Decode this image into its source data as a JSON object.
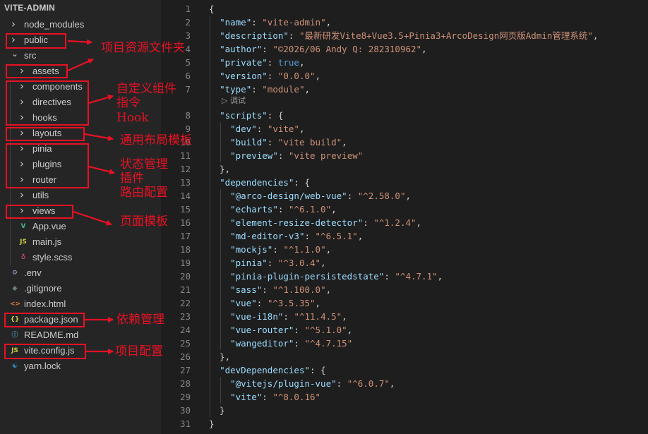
{
  "explorer": {
    "title": "VITE-ADMIN",
    "items": [
      {
        "label": "node_modules",
        "type": "folder",
        "depth": 0,
        "icon": "chevron-right-icon"
      },
      {
        "label": "public",
        "type": "folder",
        "depth": 0,
        "icon": "chevron-right-icon"
      },
      {
        "label": "src",
        "type": "folder-open",
        "depth": 0,
        "icon": "chevron-down-icon"
      },
      {
        "label": "assets",
        "type": "folder",
        "depth": 1,
        "icon": "chevron-right-icon"
      },
      {
        "label": "components",
        "type": "folder",
        "depth": 1,
        "icon": "chevron-right-icon"
      },
      {
        "label": "directives",
        "type": "folder",
        "depth": 1,
        "icon": "chevron-right-icon"
      },
      {
        "label": "hooks",
        "type": "folder",
        "depth": 1,
        "icon": "chevron-right-icon"
      },
      {
        "label": "layouts",
        "type": "folder",
        "depth": 1,
        "icon": "chevron-right-icon"
      },
      {
        "label": "pinia",
        "type": "folder",
        "depth": 1,
        "icon": "chevron-right-icon"
      },
      {
        "label": "plugins",
        "type": "folder",
        "depth": 1,
        "icon": "chevron-right-icon"
      },
      {
        "label": "router",
        "type": "folder",
        "depth": 1,
        "icon": "chevron-right-icon"
      },
      {
        "label": "utils",
        "type": "folder",
        "depth": 1,
        "icon": "chevron-right-icon"
      },
      {
        "label": "views",
        "type": "folder",
        "depth": 1,
        "icon": "chevron-right-icon"
      },
      {
        "label": "App.vue",
        "type": "file",
        "depth": 1,
        "icon": "vue-file-icon",
        "icon_color": "#41b883"
      },
      {
        "label": "main.js",
        "type": "file",
        "depth": 1,
        "icon": "js-file-icon",
        "icon_color": "#cbcb41"
      },
      {
        "label": "style.scss",
        "type": "file",
        "depth": 1,
        "icon": "scss-file-icon",
        "icon_color": "#f55385"
      },
      {
        "label": ".env",
        "type": "file",
        "depth": 0,
        "icon": "gear-icon",
        "icon_color": "#8da0cb"
      },
      {
        "label": ".gitignore",
        "type": "file",
        "depth": 0,
        "icon": "git-icon",
        "icon_color": "#6d8086"
      },
      {
        "label": "index.html",
        "type": "file",
        "depth": 0,
        "icon": "html-file-icon",
        "icon_color": "#e37933"
      },
      {
        "label": "package.json",
        "type": "file",
        "depth": 0,
        "icon": "json-file-icon",
        "icon_color": "#cbcb41"
      },
      {
        "label": "README.md",
        "type": "file",
        "depth": 0,
        "icon": "info-icon",
        "icon_color": "#519aba"
      },
      {
        "label": "vite.config.js",
        "type": "file",
        "depth": 0,
        "icon": "js-file-icon",
        "icon_color": "#cbcb41"
      },
      {
        "label": "yarn.lock",
        "type": "file",
        "depth": 0,
        "icon": "yarn-icon",
        "icon_color": "#2c8ebb"
      }
    ]
  },
  "editor": {
    "lines": [
      {
        "n": "1",
        "tokens": [
          [
            "p",
            "{"
          ]
        ]
      },
      {
        "n": "2",
        "tokens": [
          [
            "p",
            "  "
          ],
          [
            "k",
            "\"name\""
          ],
          [
            "p",
            ": "
          ],
          [
            "s",
            "\"vite-admin\""
          ],
          [
            "p",
            ","
          ]
        ]
      },
      {
        "n": "3",
        "tokens": [
          [
            "p",
            "  "
          ],
          [
            "k",
            "\"description\""
          ],
          [
            "p",
            ": "
          ],
          [
            "s",
            "\"最新研发Vite8+Vue3.5+Pinia3+ArcoDesign网页版Admin管理系统\""
          ],
          [
            "p",
            ","
          ]
        ]
      },
      {
        "n": "4",
        "tokens": [
          [
            "p",
            "  "
          ],
          [
            "k",
            "\"author\""
          ],
          [
            "p",
            ": "
          ],
          [
            "s",
            "\"©2026/06 Andy Q: 282310962\""
          ],
          [
            "p",
            ","
          ]
        ]
      },
      {
        "n": "5",
        "tokens": [
          [
            "p",
            "  "
          ],
          [
            "k",
            "\"private\""
          ],
          [
            "p",
            ": "
          ],
          [
            "b",
            "true"
          ],
          [
            "p",
            ","
          ]
        ]
      },
      {
        "n": "6",
        "tokens": [
          [
            "p",
            "  "
          ],
          [
            "k",
            "\"version\""
          ],
          [
            "p",
            ": "
          ],
          [
            "s",
            "\"0.0.0\""
          ],
          [
            "p",
            ","
          ]
        ]
      },
      {
        "n": "7",
        "tokens": [
          [
            "p",
            "  "
          ],
          [
            "k",
            "\"type\""
          ],
          [
            "p",
            ": "
          ],
          [
            "s",
            "\"module\""
          ],
          [
            "p",
            ","
          ]
        ]
      },
      {
        "n": "8",
        "tokens": [
          [
            "p",
            "  "
          ],
          [
            "k",
            "\"scripts\""
          ],
          [
            "p",
            ": {"
          ]
        ]
      },
      {
        "n": "9",
        "tokens": [
          [
            "p",
            "    "
          ],
          [
            "k",
            "\"dev\""
          ],
          [
            "p",
            ": "
          ],
          [
            "s",
            "\"vite\""
          ],
          [
            "p",
            ","
          ]
        ]
      },
      {
        "n": "10",
        "tokens": [
          [
            "p",
            "    "
          ],
          [
            "k",
            "\"build\""
          ],
          [
            "p",
            ": "
          ],
          [
            "s",
            "\"vite build\""
          ],
          [
            "p",
            ","
          ]
        ]
      },
      {
        "n": "11",
        "tokens": [
          [
            "p",
            "    "
          ],
          [
            "k",
            "\"preview\""
          ],
          [
            "p",
            ": "
          ],
          [
            "s",
            "\"vite preview\""
          ]
        ]
      },
      {
        "n": "12",
        "tokens": [
          [
            "p",
            "  },"
          ]
        ]
      },
      {
        "n": "13",
        "tokens": [
          [
            "p",
            "  "
          ],
          [
            "k",
            "\"dependencies\""
          ],
          [
            "p",
            ": {"
          ]
        ]
      },
      {
        "n": "14",
        "tokens": [
          [
            "p",
            "    "
          ],
          [
            "k",
            "\"@arco-design/web-vue\""
          ],
          [
            "p",
            ": "
          ],
          [
            "s",
            "\"^2.58.0\""
          ],
          [
            "p",
            ","
          ]
        ]
      },
      {
        "n": "15",
        "tokens": [
          [
            "p",
            "    "
          ],
          [
            "k",
            "\"echarts\""
          ],
          [
            "p",
            ": "
          ],
          [
            "s",
            "\"^6.1.0\""
          ],
          [
            "p",
            ","
          ]
        ]
      },
      {
        "n": "16",
        "tokens": [
          [
            "p",
            "    "
          ],
          [
            "k",
            "\"element-resize-detector\""
          ],
          [
            "p",
            ": "
          ],
          [
            "s",
            "\"^1.2.4\""
          ],
          [
            "p",
            ","
          ]
        ]
      },
      {
        "n": "17",
        "tokens": [
          [
            "p",
            "    "
          ],
          [
            "k",
            "\"md-editor-v3\""
          ],
          [
            "p",
            ": "
          ],
          [
            "s",
            "\"^6.5.1\""
          ],
          [
            "p",
            ","
          ]
        ]
      },
      {
        "n": "18",
        "tokens": [
          [
            "p",
            "    "
          ],
          [
            "k",
            "\"mockjs\""
          ],
          [
            "p",
            ": "
          ],
          [
            "s",
            "\"^1.1.0\""
          ],
          [
            "p",
            ","
          ]
        ]
      },
      {
        "n": "19",
        "tokens": [
          [
            "p",
            "    "
          ],
          [
            "k",
            "\"pinia\""
          ],
          [
            "p",
            ": "
          ],
          [
            "s",
            "\"^3.0.4\""
          ],
          [
            "p",
            ","
          ]
        ]
      },
      {
        "n": "20",
        "tokens": [
          [
            "p",
            "    "
          ],
          [
            "k",
            "\"pinia-plugin-persistedstate\""
          ],
          [
            "p",
            ": "
          ],
          [
            "s",
            "\"^4.7.1\""
          ],
          [
            "p",
            ","
          ]
        ]
      },
      {
        "n": "21",
        "tokens": [
          [
            "p",
            "    "
          ],
          [
            "k",
            "\"sass\""
          ],
          [
            "p",
            ": "
          ],
          [
            "s",
            "\"^1.100.0\""
          ],
          [
            "p",
            ","
          ]
        ]
      },
      {
        "n": "22",
        "tokens": [
          [
            "p",
            "    "
          ],
          [
            "k",
            "\"vue\""
          ],
          [
            "p",
            ": "
          ],
          [
            "s",
            "\"^3.5.35\""
          ],
          [
            "p",
            ","
          ]
        ]
      },
      {
        "n": "23",
        "tokens": [
          [
            "p",
            "    "
          ],
          [
            "k",
            "\"vue-i18n\""
          ],
          [
            "p",
            ": "
          ],
          [
            "s",
            "\"^11.4.5\""
          ],
          [
            "p",
            ","
          ]
        ]
      },
      {
        "n": "24",
        "tokens": [
          [
            "p",
            "    "
          ],
          [
            "k",
            "\"vue-router\""
          ],
          [
            "p",
            ": "
          ],
          [
            "s",
            "\"^5.1.0\""
          ],
          [
            "p",
            ","
          ]
        ]
      },
      {
        "n": "25",
        "tokens": [
          [
            "p",
            "    "
          ],
          [
            "k",
            "\"wangeditor\""
          ],
          [
            "p",
            ": "
          ],
          [
            "s",
            "\"^4.7.15\""
          ]
        ]
      },
      {
        "n": "26",
        "tokens": [
          [
            "p",
            "  },"
          ]
        ]
      },
      {
        "n": "27",
        "tokens": [
          [
            "p",
            "  "
          ],
          [
            "k",
            "\"devDependencies\""
          ],
          [
            "p",
            ": {"
          ]
        ]
      },
      {
        "n": "28",
        "tokens": [
          [
            "p",
            "    "
          ],
          [
            "k",
            "\"@vitejs/plugin-vue\""
          ],
          [
            "p",
            ": "
          ],
          [
            "s",
            "\"^6.0.7\""
          ],
          [
            "p",
            ","
          ]
        ]
      },
      {
        "n": "29",
        "tokens": [
          [
            "p",
            "    "
          ],
          [
            "k",
            "\"vite\""
          ],
          [
            "p",
            ": "
          ],
          [
            "s",
            "\"^8.0.16\""
          ]
        ]
      },
      {
        "n": "30",
        "tokens": [
          [
            "p",
            "  }"
          ]
        ]
      },
      {
        "n": "31",
        "tokens": [
          [
            "p",
            "}"
          ]
        ]
      }
    ],
    "codelens": "▷ 调试"
  },
  "annotations": {
    "public": "项目资源文件夹",
    "components_line1": "自定义组件",
    "components_line2": "指令",
    "components_line3": "Hook",
    "layouts": "通用布局模板",
    "pinia_line1": "状态管理",
    "pinia_line2": "插件",
    "pinia_line3": "路由配置",
    "views": "页面模板",
    "package": "依赖管理",
    "viteconfig": "项目配置"
  },
  "colors": {
    "annotation_red": "#e81123",
    "json_key": "#9cdcfe",
    "json_string": "#ce9178",
    "json_bool": "#569cd6"
  }
}
